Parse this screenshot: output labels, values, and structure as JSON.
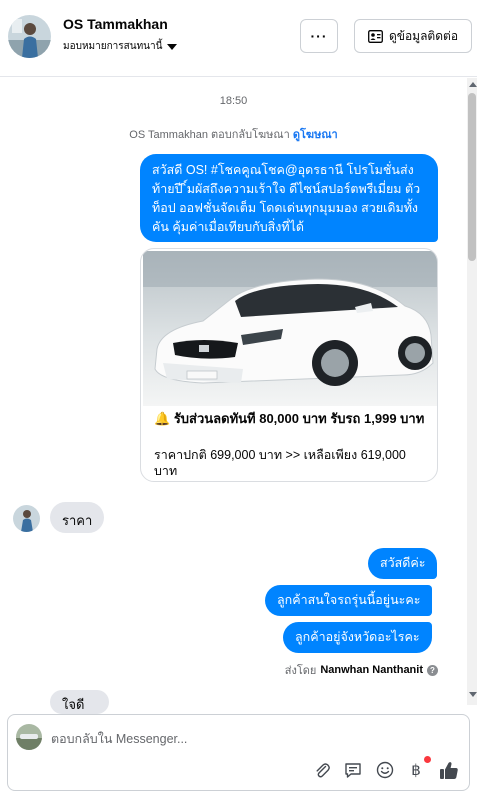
{
  "header": {
    "name": "OS Tammakhan",
    "assign_label": "มอบหมายการสนทนานี้",
    "more_label": "···",
    "contact_label": "ดูข้อมูลติดต่อ"
  },
  "conversation": {
    "time": "18:50",
    "ad_reply_prefix": "OS Tammakhan ตอบกลับโฆษณา",
    "ad_reply_link": "ดูโฆษณา",
    "messages_out_1": "สวัสดี OS! #โชคคูณโชค@อุดรธานี โปรโมชั่นส่งท้ายปี ิ์มผัสถึงความเร้าใจ ดีไซน์สปอร์ตพรีเมี่ยม ตัวท็อป ออฟชั่นจัดเต็ม โดดเด่นทุกมุมมอง สวยเดิมทั้งคัน คุ้มค่าเมื่อเทียบกับสิ่งที่ได้",
    "card": {
      "headline_icon": "🔔",
      "headline": "รับส่วนลดทันที 80,000 บาท รับรถ 1,999 บาท",
      "description": "ราคาปกติ 699,000 บาท >> เหลือเพียง 619,000 บาท"
    },
    "incoming_1": "ราคา",
    "outgoing_2": "สวัสดีค่ะ",
    "outgoing_3": "ลูกค้าสนใจรถรุ่นนี้อยู่นะคะ",
    "outgoing_4": "ลูกค้าอยู่จังหวัดอะไรคะ",
    "sent_by_prefix": "ส่งโดย",
    "sent_by_name": "Nanwhan Nanthanit",
    "incoming_2": "ใจดีนะ"
  },
  "composer": {
    "placeholder": "ตอบกลับใน Messenger...",
    "baht_symbol": "฿"
  },
  "colors": {
    "accent": "#0084ff",
    "link": "#1877f2",
    "incoming_bubble": "#e4e6eb",
    "notification_dot": "#fa383e"
  }
}
